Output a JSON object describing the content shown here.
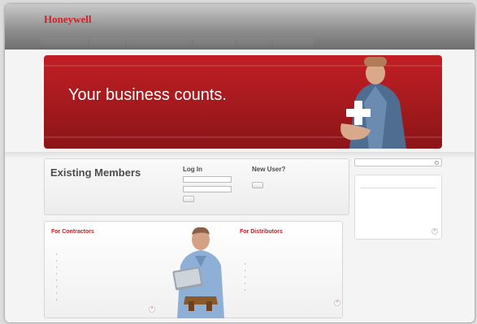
{
  "header": {
    "brand": "Honeywell",
    "tagline": "",
    "utility_links": [
      "",
      ""
    ]
  },
  "nav": {
    "items": [
      "",
      "",
      "",
      "",
      "",
      ""
    ]
  },
  "hero": {
    "title": "Your business counts."
  },
  "members": {
    "title": "Existing Members",
    "description": ""
  },
  "login": {
    "title": "Log In",
    "username_placeholder": "",
    "password_placeholder": "",
    "button": "",
    "forgot": ""
  },
  "newuser": {
    "title": "New User?",
    "description": "",
    "button": ""
  },
  "contractors": {
    "title": "For Contractors",
    "description": "",
    "benefits": [
      "",
      "",
      "",
      "",
      "",
      "",
      "",
      ""
    ],
    "see_all": ""
  },
  "distributors": {
    "title": "For Distributors",
    "description": "",
    "benefits": [
      "",
      "",
      "",
      "",
      ""
    ],
    "see_all": ""
  },
  "sidebar": {
    "search_label": "",
    "opps_title": "",
    "opps_items": [
      "",
      "",
      ""
    ],
    "see_all": ""
  },
  "colors": {
    "brand_red": "#c11f24",
    "nav_gray": "#7a7a7a"
  }
}
